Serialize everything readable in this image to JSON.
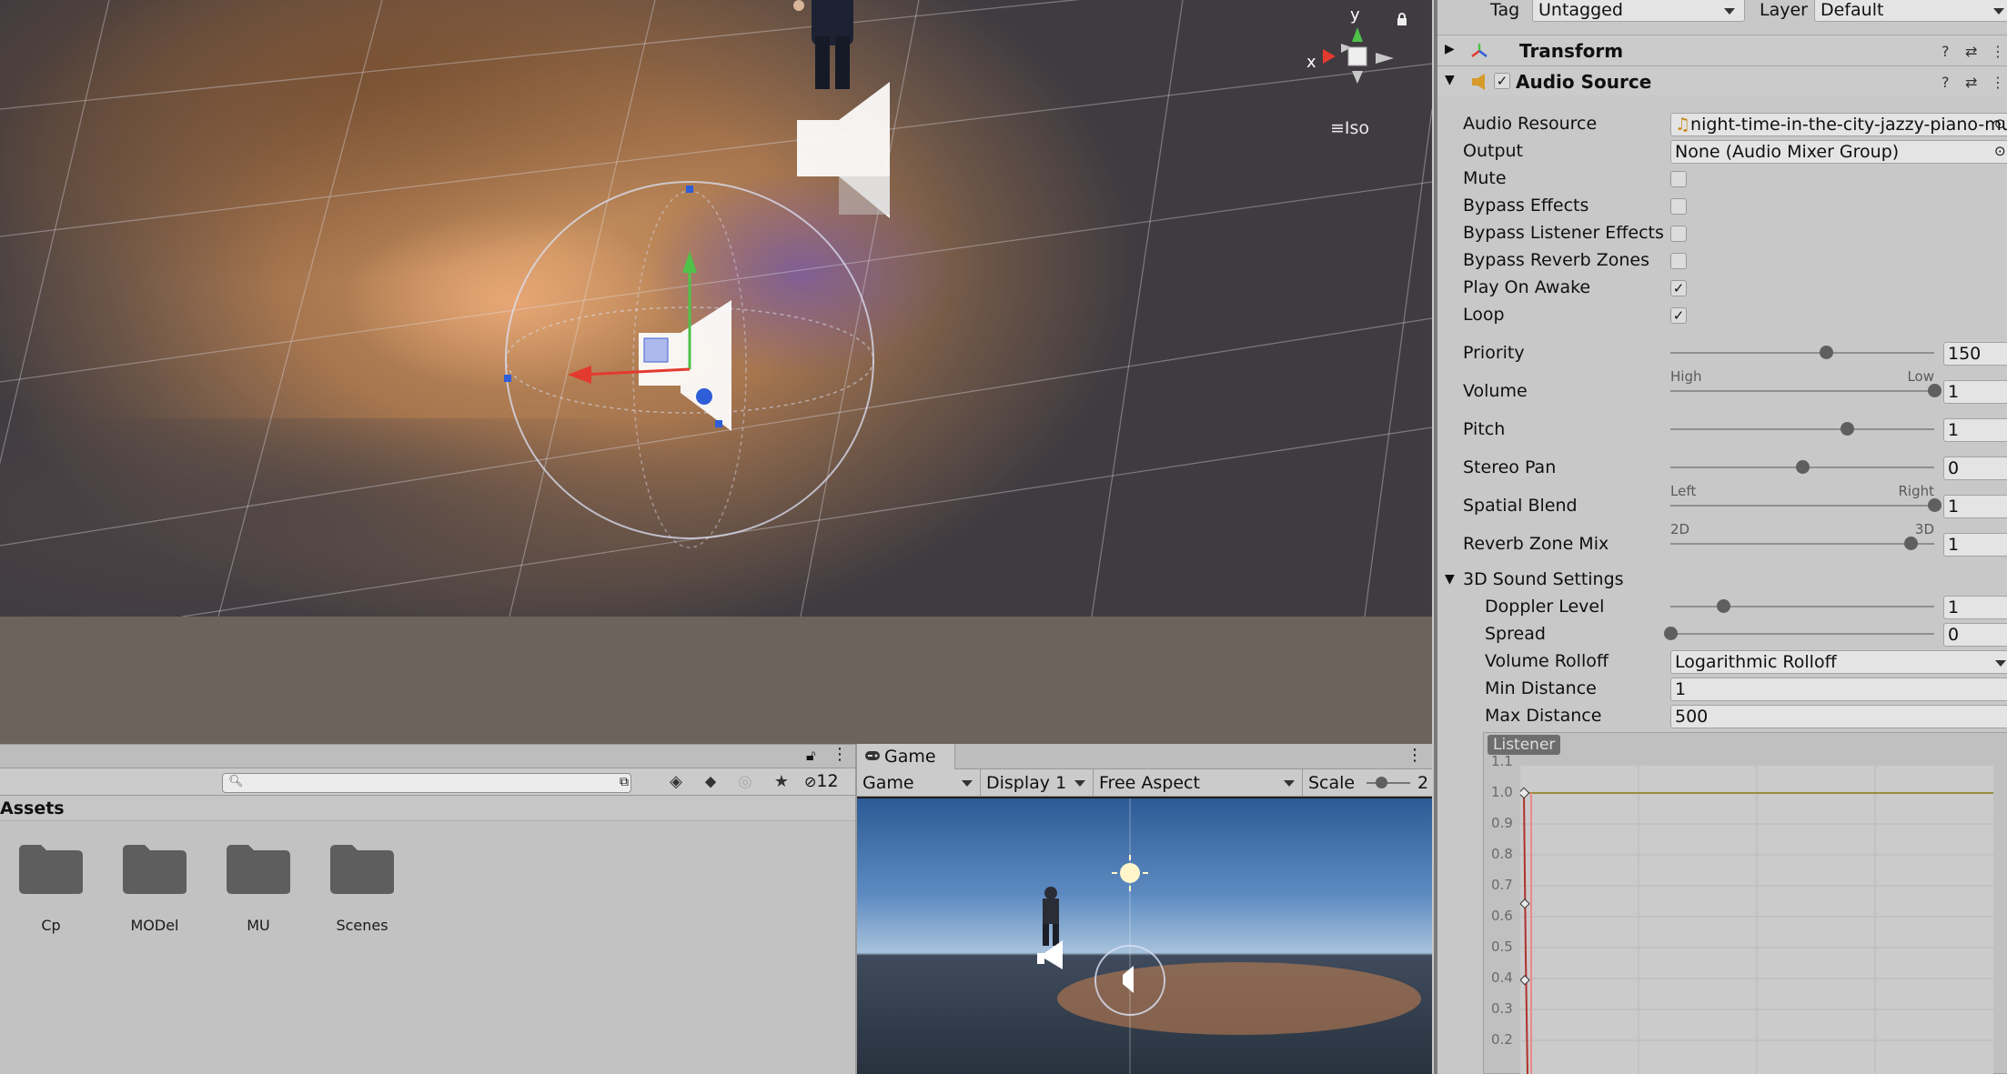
{
  "scene": {
    "gizmo_x": "x",
    "gizmo_y": "y",
    "projection_label": "Iso"
  },
  "project": {
    "assets_header": "Assets",
    "search_placeholder": "",
    "hidden_count": "12",
    "folders": [
      "Cp",
      "MODel",
      "MU",
      "Scenes"
    ]
  },
  "game": {
    "tab_label": "Game",
    "view_mode": "Game",
    "display": "Display 1",
    "aspect": "Free Aspect",
    "scale_label": "Scale",
    "scale_value": "2"
  },
  "inspector": {
    "tag_label": "Tag",
    "tag_value": "Untagged",
    "layer_label": "Layer",
    "layer_value": "Default",
    "transform_title": "Transform",
    "audio_source_title": "Audio Source",
    "audio_resource_label": "Audio Resource",
    "audio_resource_value": "night-time-in-the-city-jazzy-piano-mu",
    "output_label": "Output",
    "output_value": "None (Audio Mixer Group)",
    "toggles": [
      {
        "label": "Mute",
        "checked": false
      },
      {
        "label": "Bypass Effects",
        "checked": false
      },
      {
        "label": "Bypass Listener Effects",
        "checked": false
      },
      {
        "label": "Bypass Reverb Zones",
        "checked": false
      },
      {
        "label": "Play On Awake",
        "checked": true
      },
      {
        "label": "Loop",
        "checked": true
      }
    ],
    "check_glyph": "✓",
    "priority": {
      "label": "Priority",
      "value": "150",
      "fraction": 0.59,
      "min_label": "High",
      "max_label": "Low"
    },
    "volume": {
      "label": "Volume",
      "value": "1",
      "fraction": 1.0
    },
    "pitch": {
      "label": "Pitch",
      "value": "1",
      "fraction": 0.67
    },
    "stereo_pan": {
      "label": "Stereo Pan",
      "value": "0",
      "fraction": 0.5,
      "min_label": "Left",
      "max_label": "Right"
    },
    "spatial_blend": {
      "label": "Spatial Blend",
      "value": "1",
      "fraction": 1.0,
      "min_label": "2D",
      "max_label": "3D"
    },
    "reverb_zone_mix": {
      "label": "Reverb Zone Mix",
      "value": "1",
      "fraction": 0.91
    },
    "sound3d_header": "3D Sound Settings",
    "doppler": {
      "label": "Doppler Level",
      "value": "1",
      "fraction": 0.2
    },
    "spread": {
      "label": "Spread",
      "value": "0",
      "fraction": 0.0
    },
    "volume_rolloff_label": "Volume Rolloff",
    "volume_rolloff_value": "Logarithmic Rolloff",
    "min_distance_label": "Min Distance",
    "min_distance_value": "1",
    "max_distance_label": "Max Distance",
    "max_distance_value": "500",
    "graph": {
      "listener_label": "Listener",
      "y_ticks": [
        "1.1",
        "1.0",
        "0.9",
        "0.8",
        "0.7",
        "0.6",
        "0.5",
        "0.4",
        "0.3",
        "0.2"
      ]
    }
  },
  "colors": {
    "accent_red": "#e33a2f",
    "accent_green": "#4fc24a",
    "accent_blue": "#2e5ed8"
  }
}
